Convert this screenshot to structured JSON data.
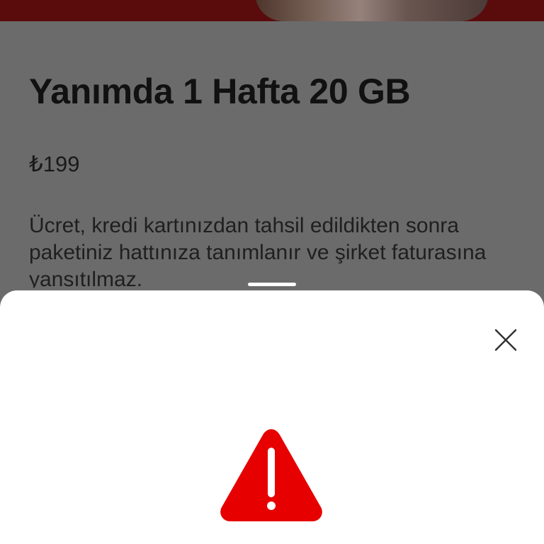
{
  "package": {
    "title": "Yanımda 1 Hafta 20 GB",
    "price": "₺199",
    "description": "Ücret, kredi kartınızdan tahsil edildikten sonra paketiniz hattınıza tanımlanır ve şirket faturasına yansıtılmaz."
  },
  "sheet": {
    "close_icon": "close-icon",
    "alert_icon": "warning-triangle-icon"
  },
  "colors": {
    "brand_red": "#E60000",
    "overlay_gray": "#6B6B6B",
    "sheet_bg": "#FFFFFF",
    "text_dark": "#111111"
  }
}
